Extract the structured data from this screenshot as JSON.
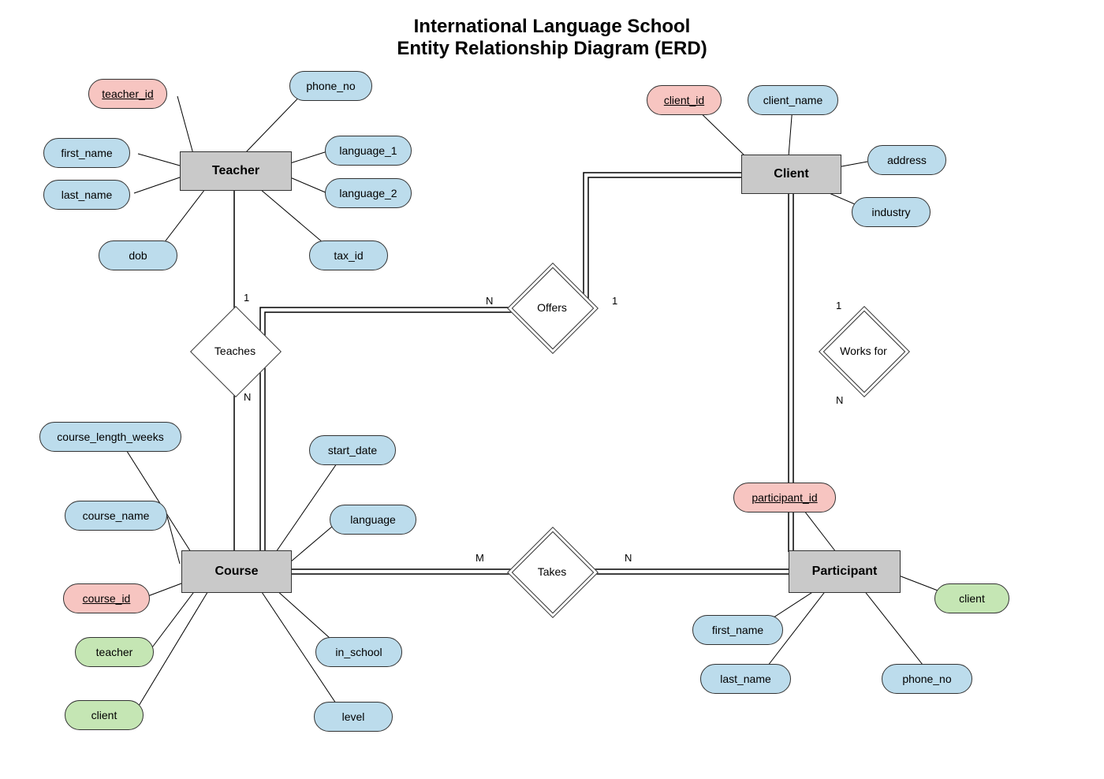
{
  "title": {
    "line1": "International Language School",
    "line2": "Entity Relationship Diagram (ERD)"
  },
  "entities": {
    "teacher": {
      "label": "Teacher"
    },
    "client": {
      "label": "Client"
    },
    "course": {
      "label": "Course"
    },
    "participant": {
      "label": "Participant"
    }
  },
  "relationships": {
    "teaches": {
      "label": "Teaches",
      "card_top": "1",
      "card_bottom": "N",
      "total": false
    },
    "offers": {
      "label": "Offers",
      "card_left": "N",
      "card_right": "1",
      "total": true
    },
    "works_for": {
      "label": "Works for",
      "card_top": "1",
      "card_bottom": "N",
      "total": true
    },
    "takes": {
      "label": "Takes",
      "card_left": "M",
      "card_right": "N",
      "total": true
    }
  },
  "attributes": {
    "teacher": {
      "teacher_id": "teacher_id",
      "first_name": "first_name",
      "last_name": "last_name",
      "dob": "dob",
      "phone_no": "phone_no",
      "language_1": "language_1",
      "language_2": "language_2",
      "tax_id": "tax_id"
    },
    "client": {
      "client_id": "client_id",
      "client_name": "client_name",
      "address": "address",
      "industry": "industry"
    },
    "course": {
      "course_length_weeks": "course_length_weeks",
      "course_name": "course_name",
      "course_id": "course_id",
      "teacher": "teacher",
      "client": "client",
      "start_date": "start_date",
      "language": "language",
      "in_school": "in_school",
      "level": "level"
    },
    "participant": {
      "participant_id": "participant_id",
      "first_name": "first_name",
      "last_name": "last_name",
      "phone_no": "phone_no",
      "client": "client"
    }
  }
}
